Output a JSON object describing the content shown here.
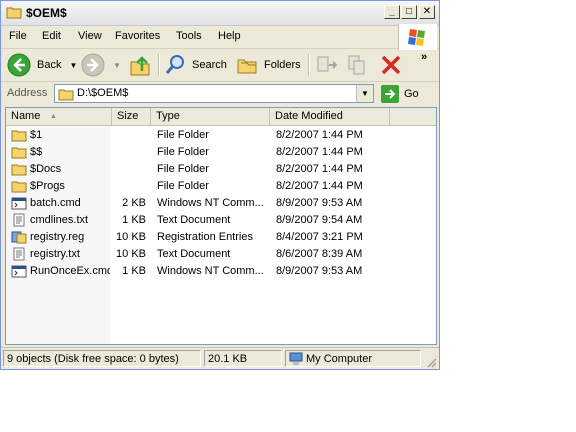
{
  "window": {
    "title": "$OEM$"
  },
  "menu": {
    "file": "File",
    "edit": "Edit",
    "view": "View",
    "favorites": "Favorites",
    "tools": "Tools",
    "help": "Help"
  },
  "toolbar": {
    "back": "Back",
    "search": "Search",
    "folders": "Folders"
  },
  "address": {
    "label": "Address",
    "path": "D:\\$OEM$",
    "go": "Go"
  },
  "columns": {
    "name": "Name",
    "size": "Size",
    "type": "Type",
    "modified": "Date Modified"
  },
  "files": [
    {
      "name": "$1",
      "size": "",
      "type": "File Folder",
      "modified": "8/2/2007 1:44 PM",
      "icon": "folder-icon"
    },
    {
      "name": "$$",
      "size": "",
      "type": "File Folder",
      "modified": "8/2/2007 1:44 PM",
      "icon": "folder-icon"
    },
    {
      "name": "$Docs",
      "size": "",
      "type": "File Folder",
      "modified": "8/2/2007 1:44 PM",
      "icon": "folder-icon"
    },
    {
      "name": "$Progs",
      "size": "",
      "type": "File Folder",
      "modified": "8/2/2007 1:44 PM",
      "icon": "folder-icon"
    },
    {
      "name": "batch.cmd",
      "size": "2 KB",
      "type": "Windows NT Comm...",
      "modified": "8/9/2007 9:53 AM",
      "icon": "cmd-icon"
    },
    {
      "name": "cmdlines.txt",
      "size": "1 KB",
      "type": "Text Document",
      "modified": "8/9/2007 9:54 AM",
      "icon": "text-file-icon"
    },
    {
      "name": "registry.reg",
      "size": "10 KB",
      "type": "Registration Entries",
      "modified": "8/4/2007 3:21 PM",
      "icon": "registry-icon"
    },
    {
      "name": "registry.txt",
      "size": "10 KB",
      "type": "Text Document",
      "modified": "8/6/2007 8:39 AM",
      "icon": "text-file-icon"
    },
    {
      "name": "RunOnceEx.cmd",
      "size": "1 KB",
      "type": "Windows NT Comm...",
      "modified": "8/9/2007 9:53 AM",
      "icon": "cmd-icon"
    }
  ],
  "status": {
    "objects": "9 objects (Disk free space: 0 bytes)",
    "size": "20.1 KB",
    "zone": "My Computer"
  },
  "colors": {
    "folder": "#f4d36a",
    "back_green": "#3aa534",
    "stop_red": "#d9281f",
    "list_border": "#7f9db9"
  }
}
